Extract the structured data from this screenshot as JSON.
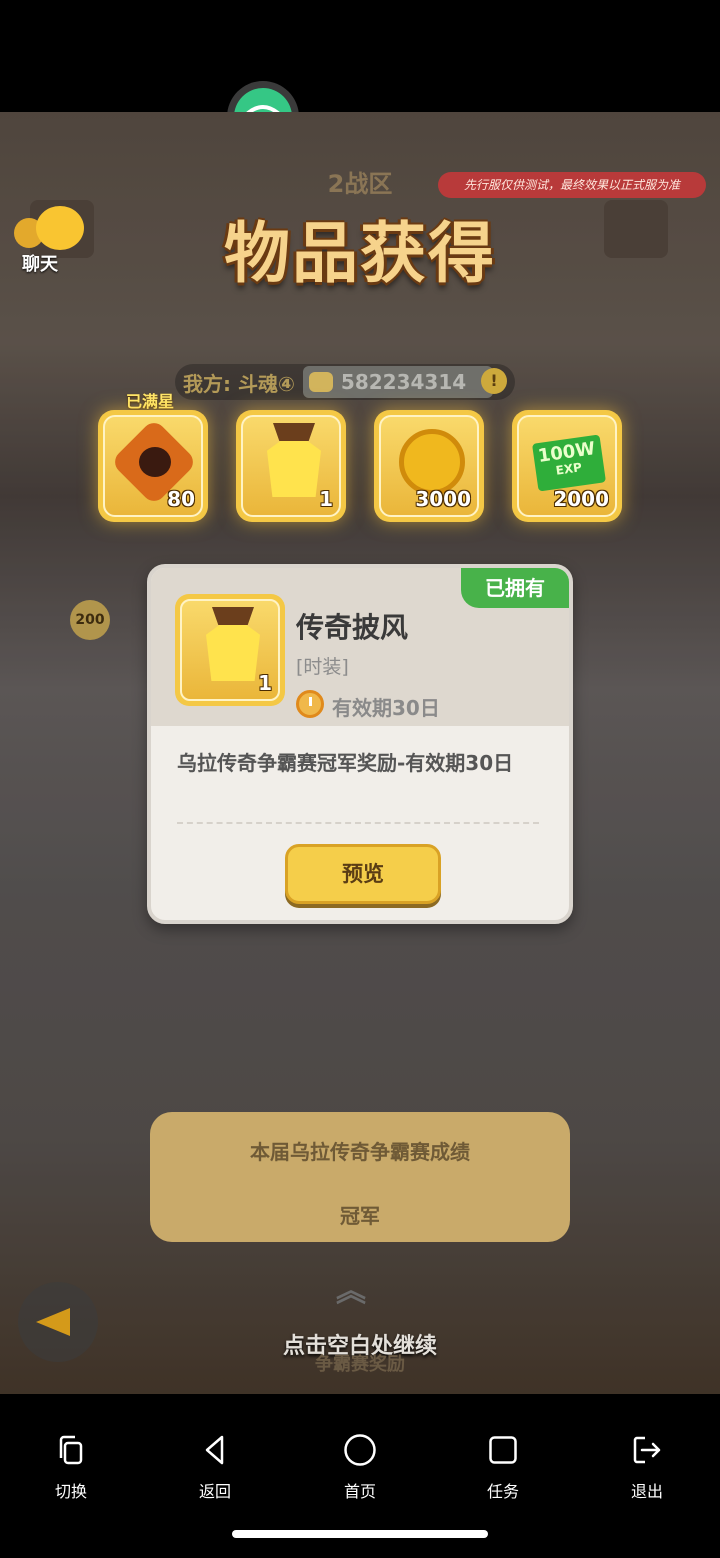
{
  "game": {
    "zone_label": "2战区",
    "tip": "先行服仅供测试，最终效果以正式服为准",
    "title": "物品获得",
    "chat_label": "聊天",
    "power": {
      "label": "我方: 斗魂④",
      "value": "582234314",
      "alert_icon": "!"
    },
    "full_star_label": "已满星",
    "rewards": [
      {
        "icon": "gem-icon",
        "qty": "80"
      },
      {
        "icon": "cape-icon",
        "qty": "1"
      },
      {
        "icon": "coin-icon",
        "qty": "3000"
      },
      {
        "icon": "exp-ticket-icon",
        "qty": "2000",
        "ticket_text": "100W",
        "ticket_sub": "EXP"
      }
    ],
    "bg_badge": "200",
    "modal": {
      "owned_tag": "已拥有",
      "item_name": "传奇披风",
      "item_type": "[时装]",
      "item_qty": "1",
      "validity": "有效期30日",
      "description": "乌拉传奇争霸赛冠军奖励-有效期30日",
      "preview_button": "预览"
    },
    "scroll": {
      "title": "本届乌拉传奇争霸赛成绩",
      "rank": "冠军"
    },
    "continue_hint": "点击空白处继续",
    "continue_sub": "争霸赛奖励"
  },
  "navbar": {
    "items": [
      {
        "label": "切换",
        "icon": "switch-icon"
      },
      {
        "label": "返回",
        "icon": "back-icon"
      },
      {
        "label": "首页",
        "icon": "home-icon"
      },
      {
        "label": "任务",
        "icon": "tasks-icon"
      },
      {
        "label": "退出",
        "icon": "exit-icon"
      }
    ]
  },
  "colors": {
    "accent_gold": "#f4c845",
    "owned_green": "#48b24a",
    "tip_red": "#b83a3a",
    "wifi_green": "#35c785"
  }
}
